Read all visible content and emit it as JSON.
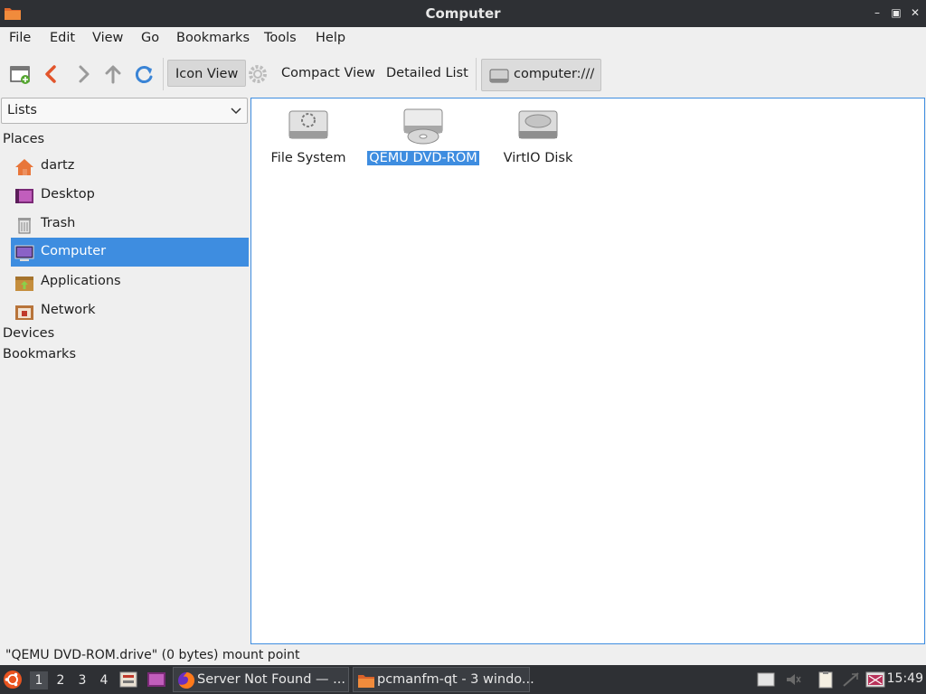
{
  "window": {
    "title": "Computer"
  },
  "menu": [
    "File",
    "Edit",
    "View",
    "Go",
    "Bookmarks",
    "Tools",
    "Help"
  ],
  "toolbar": {
    "views": [
      "Icon View",
      "Compact View",
      "Detailed List"
    ],
    "active_view": "Icon View",
    "location": "computer:///"
  },
  "side_pane": {
    "mode": "Lists",
    "groups": {
      "places": "Places",
      "devices": "Devices",
      "bookmarks": "Bookmarks"
    },
    "places": [
      {
        "label": "dartz",
        "icon": "home-folder-icon"
      },
      {
        "label": "Desktop",
        "icon": "desktop-icon"
      },
      {
        "label": "Trash",
        "icon": "trash-icon"
      },
      {
        "label": "Computer",
        "icon": "computer-icon",
        "selected": true
      },
      {
        "label": "Applications",
        "icon": "applications-icon"
      },
      {
        "label": "Network",
        "icon": "network-icon"
      }
    ]
  },
  "content": {
    "items": [
      {
        "label": "File System",
        "icon": "filesystem-drive-icon"
      },
      {
        "label": "QEMU DVD-ROM",
        "icon": "optical-drive-icon",
        "selected": true
      },
      {
        "label": "VirtIO Disk",
        "icon": "hard-disk-icon"
      }
    ]
  },
  "status": "\"QEMU DVD-ROM.drive\" (0 bytes) mount point",
  "taskbar": {
    "workspaces": [
      "1",
      "2",
      "3",
      "4"
    ],
    "active_workspace": "1",
    "tasks": [
      {
        "label": "Server Not Found — ...",
        "icon": "firefox-icon"
      },
      {
        "label": "pcmanfm-qt - 3 windo...",
        "icon": "folder-icon"
      }
    ],
    "clock": "15:49"
  },
  "colors": {
    "accent": "#3e8de0",
    "titlebar": "#2e3034",
    "chrome": "#efefef"
  }
}
